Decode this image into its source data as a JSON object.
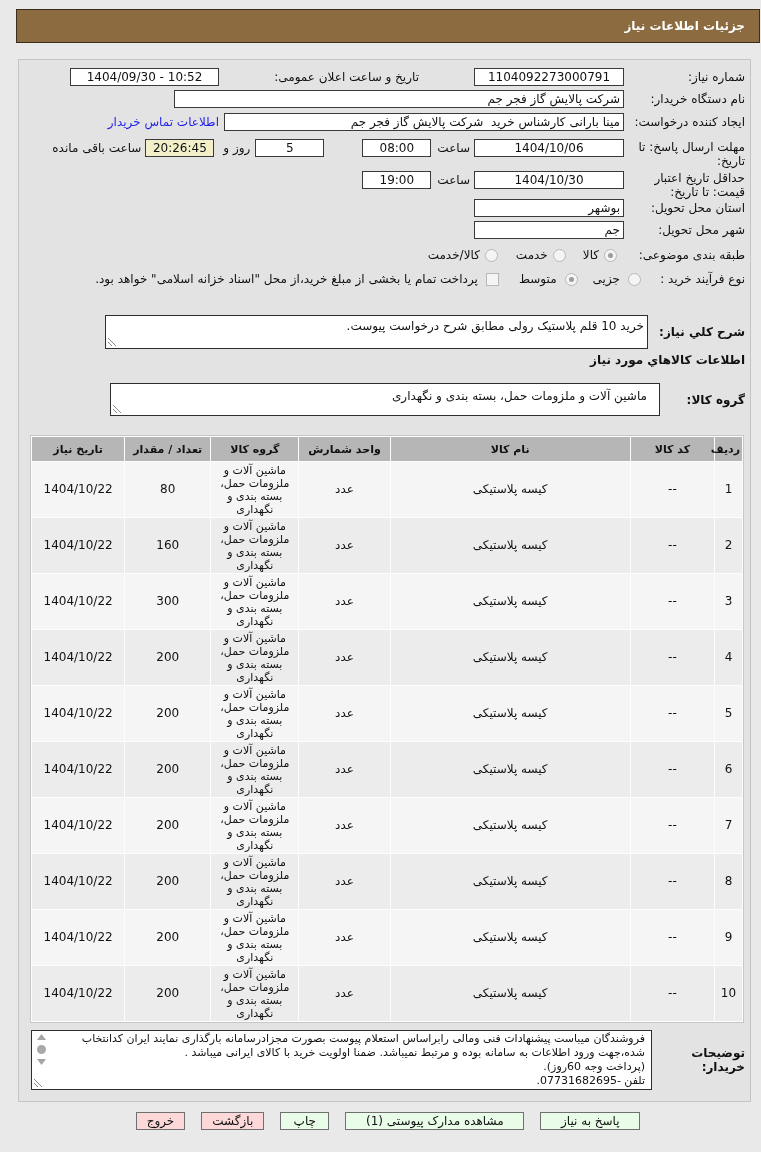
{
  "header": {
    "title": "جزئیات اطلاعات نیاز"
  },
  "form": {
    "need_number": {
      "label": "شماره نیاز:",
      "value": "1104092273000791"
    },
    "announcement": {
      "label": "تاریخ و ساعت اعلان عمومی:",
      "value": "1404/09/30 - 10:52"
    },
    "buyer_org": {
      "label": "نام دستگاه خریدار:",
      "value": "شرکت پالایش گاز فجر جم"
    },
    "requester": {
      "label": "ایجاد کننده درخواست:",
      "value": "مینا بارانی کارشناس خرید  شرکت پالایش گاز فجر جم",
      "contact_link": "اطلاعات تماس خریدار"
    },
    "response_deadline": {
      "label": "مهلت ارسال پاسخ: تا تاریخ:",
      "date": "1404/10/06",
      "time_label": "ساعت",
      "time": "08:00",
      "days": "5",
      "days_label": "روز و",
      "remaining": "20:26:45",
      "remaining_label": "ساعت باقی مانده"
    },
    "price_validity": {
      "label": "حداقل تاریخ اعتبار قیمت: تا تاریخ:",
      "date": "1404/10/30",
      "time_label": "ساعت",
      "time": "19:00"
    },
    "delivery_province": {
      "label": "استان محل تحویل:",
      "value": "بوشهر"
    },
    "delivery_city": {
      "label": "شهر محل تحویل:",
      "value": "جم"
    },
    "category": {
      "label": "طبقه بندی موضوعی:",
      "options": [
        {
          "label": "کالا",
          "selected": true
        },
        {
          "label": "خدمت",
          "selected": false
        },
        {
          "label": "کالا/خدمت",
          "selected": false
        }
      ]
    },
    "purchase_process": {
      "label": "نوع فرآیند خرید :",
      "options": [
        {
          "label": "جزیی",
          "selected": false
        },
        {
          "label": "متوسط",
          "selected": true
        }
      ],
      "treasury": {
        "label": "پرداخت تمام یا بخشی از مبلغ خرید،از محل \"اسناد خزانه اسلامی\" خواهد بود.",
        "checked": false
      }
    },
    "description": {
      "label": "شرح کلي نیاز:",
      "value": "خرید 10 قلم پلاستیک رولی مطابق شرح درخواست پیوست."
    }
  },
  "goods": {
    "title": "اطلاعات کالاهاي مورد نیاز",
    "group_label": "گروه کالا:",
    "group_value": "ماشین آلات و ملزومات حمل، بسته بندی و نگهداری"
  },
  "table": {
    "columns": [
      "ردیف",
      "کد کالا",
      "نام کالا",
      "واحد شمارش",
      "گروه کالا",
      "تعداد / مقدار",
      "تاریخ نیاز"
    ],
    "rows": [
      {
        "row_no": "1",
        "code": "--",
        "name": "کیسه پلاستیکی",
        "unit": "عدد",
        "group": "ماشین آلات و ملزومات حمل، بسته بندی و نگهداری",
        "quantity": "80",
        "date": "1404/10/22"
      },
      {
        "row_no": "2",
        "code": "--",
        "name": "کیسه پلاستیکی",
        "unit": "عدد",
        "group": "ماشین آلات و ملزومات حمل، بسته بندی و نگهداری",
        "quantity": "160",
        "date": "1404/10/22"
      },
      {
        "row_no": "3",
        "code": "--",
        "name": "کیسه پلاستیکی",
        "unit": "عدد",
        "group": "ماشین آلات و ملزومات حمل، بسته بندی و نگهداری",
        "quantity": "300",
        "date": "1404/10/22"
      },
      {
        "row_no": "4",
        "code": "--",
        "name": "کیسه پلاستیکی",
        "unit": "عدد",
        "group": "ماشین آلات و ملزومات حمل، بسته بندی و نگهداری",
        "quantity": "200",
        "date": "1404/10/22"
      },
      {
        "row_no": "5",
        "code": "--",
        "name": "کیسه پلاستیکی",
        "unit": "عدد",
        "group": "ماشین آلات و ملزومات حمل، بسته بندی و نگهداری",
        "quantity": "200",
        "date": "1404/10/22"
      },
      {
        "row_no": "6",
        "code": "--",
        "name": "کیسه پلاستیکی",
        "unit": "عدد",
        "group": "ماشین آلات و ملزومات حمل، بسته بندی و نگهداری",
        "quantity": "200",
        "date": "1404/10/22"
      },
      {
        "row_no": "7",
        "code": "--",
        "name": "کیسه پلاستیکی",
        "unit": "عدد",
        "group": "ماشین آلات و ملزومات حمل، بسته بندی و نگهداری",
        "quantity": "200",
        "date": "1404/10/22"
      },
      {
        "row_no": "8",
        "code": "--",
        "name": "کیسه پلاستیکی",
        "unit": "عدد",
        "group": "ماشین آلات و ملزومات حمل، بسته بندی و نگهداری",
        "quantity": "200",
        "date": "1404/10/22"
      },
      {
        "row_no": "9",
        "code": "--",
        "name": "کیسه پلاستیکی",
        "unit": "عدد",
        "group": "ماشین آلات و ملزومات حمل، بسته بندی و نگهداری",
        "quantity": "200",
        "date": "1404/10/22"
      },
      {
        "row_no": "10",
        "code": "--",
        "name": "کیسه پلاستیکی",
        "unit": "عدد",
        "group": "ماشین آلات و ملزومات حمل، بسته بندی و نگهداری",
        "quantity": "200",
        "date": "1404/10/22"
      }
    ]
  },
  "buyer_notes": {
    "label": "توضیحات خریدار:",
    "paragraphs": [
      "فروشندگان میباست پیشنهادات فنی ومالی رابراساس استعلام پیوست بصورت مجزادرسامانه بارگذاری نمایند ایران کدانتخاب شده،جهت ورود اطلاعات به سامانه بوده و مرتبط نمیباشد. ضمنا اولویت خرید با کالای ایرانی میباشد .",
      "(پرداخت وجه 60روز).",
      "تلفن -07731682695."
    ]
  },
  "buttons": [
    {
      "label": "پاسخ به نیاز",
      "kind": "action"
    },
    {
      "label": "مشاهده مدارک پیوستی (1)",
      "kind": "action"
    },
    {
      "label": "چاپ",
      "kind": "action"
    },
    {
      "label": "بازگشت",
      "kind": "exit"
    },
    {
      "label": "خروج",
      "kind": "exit"
    }
  ]
}
